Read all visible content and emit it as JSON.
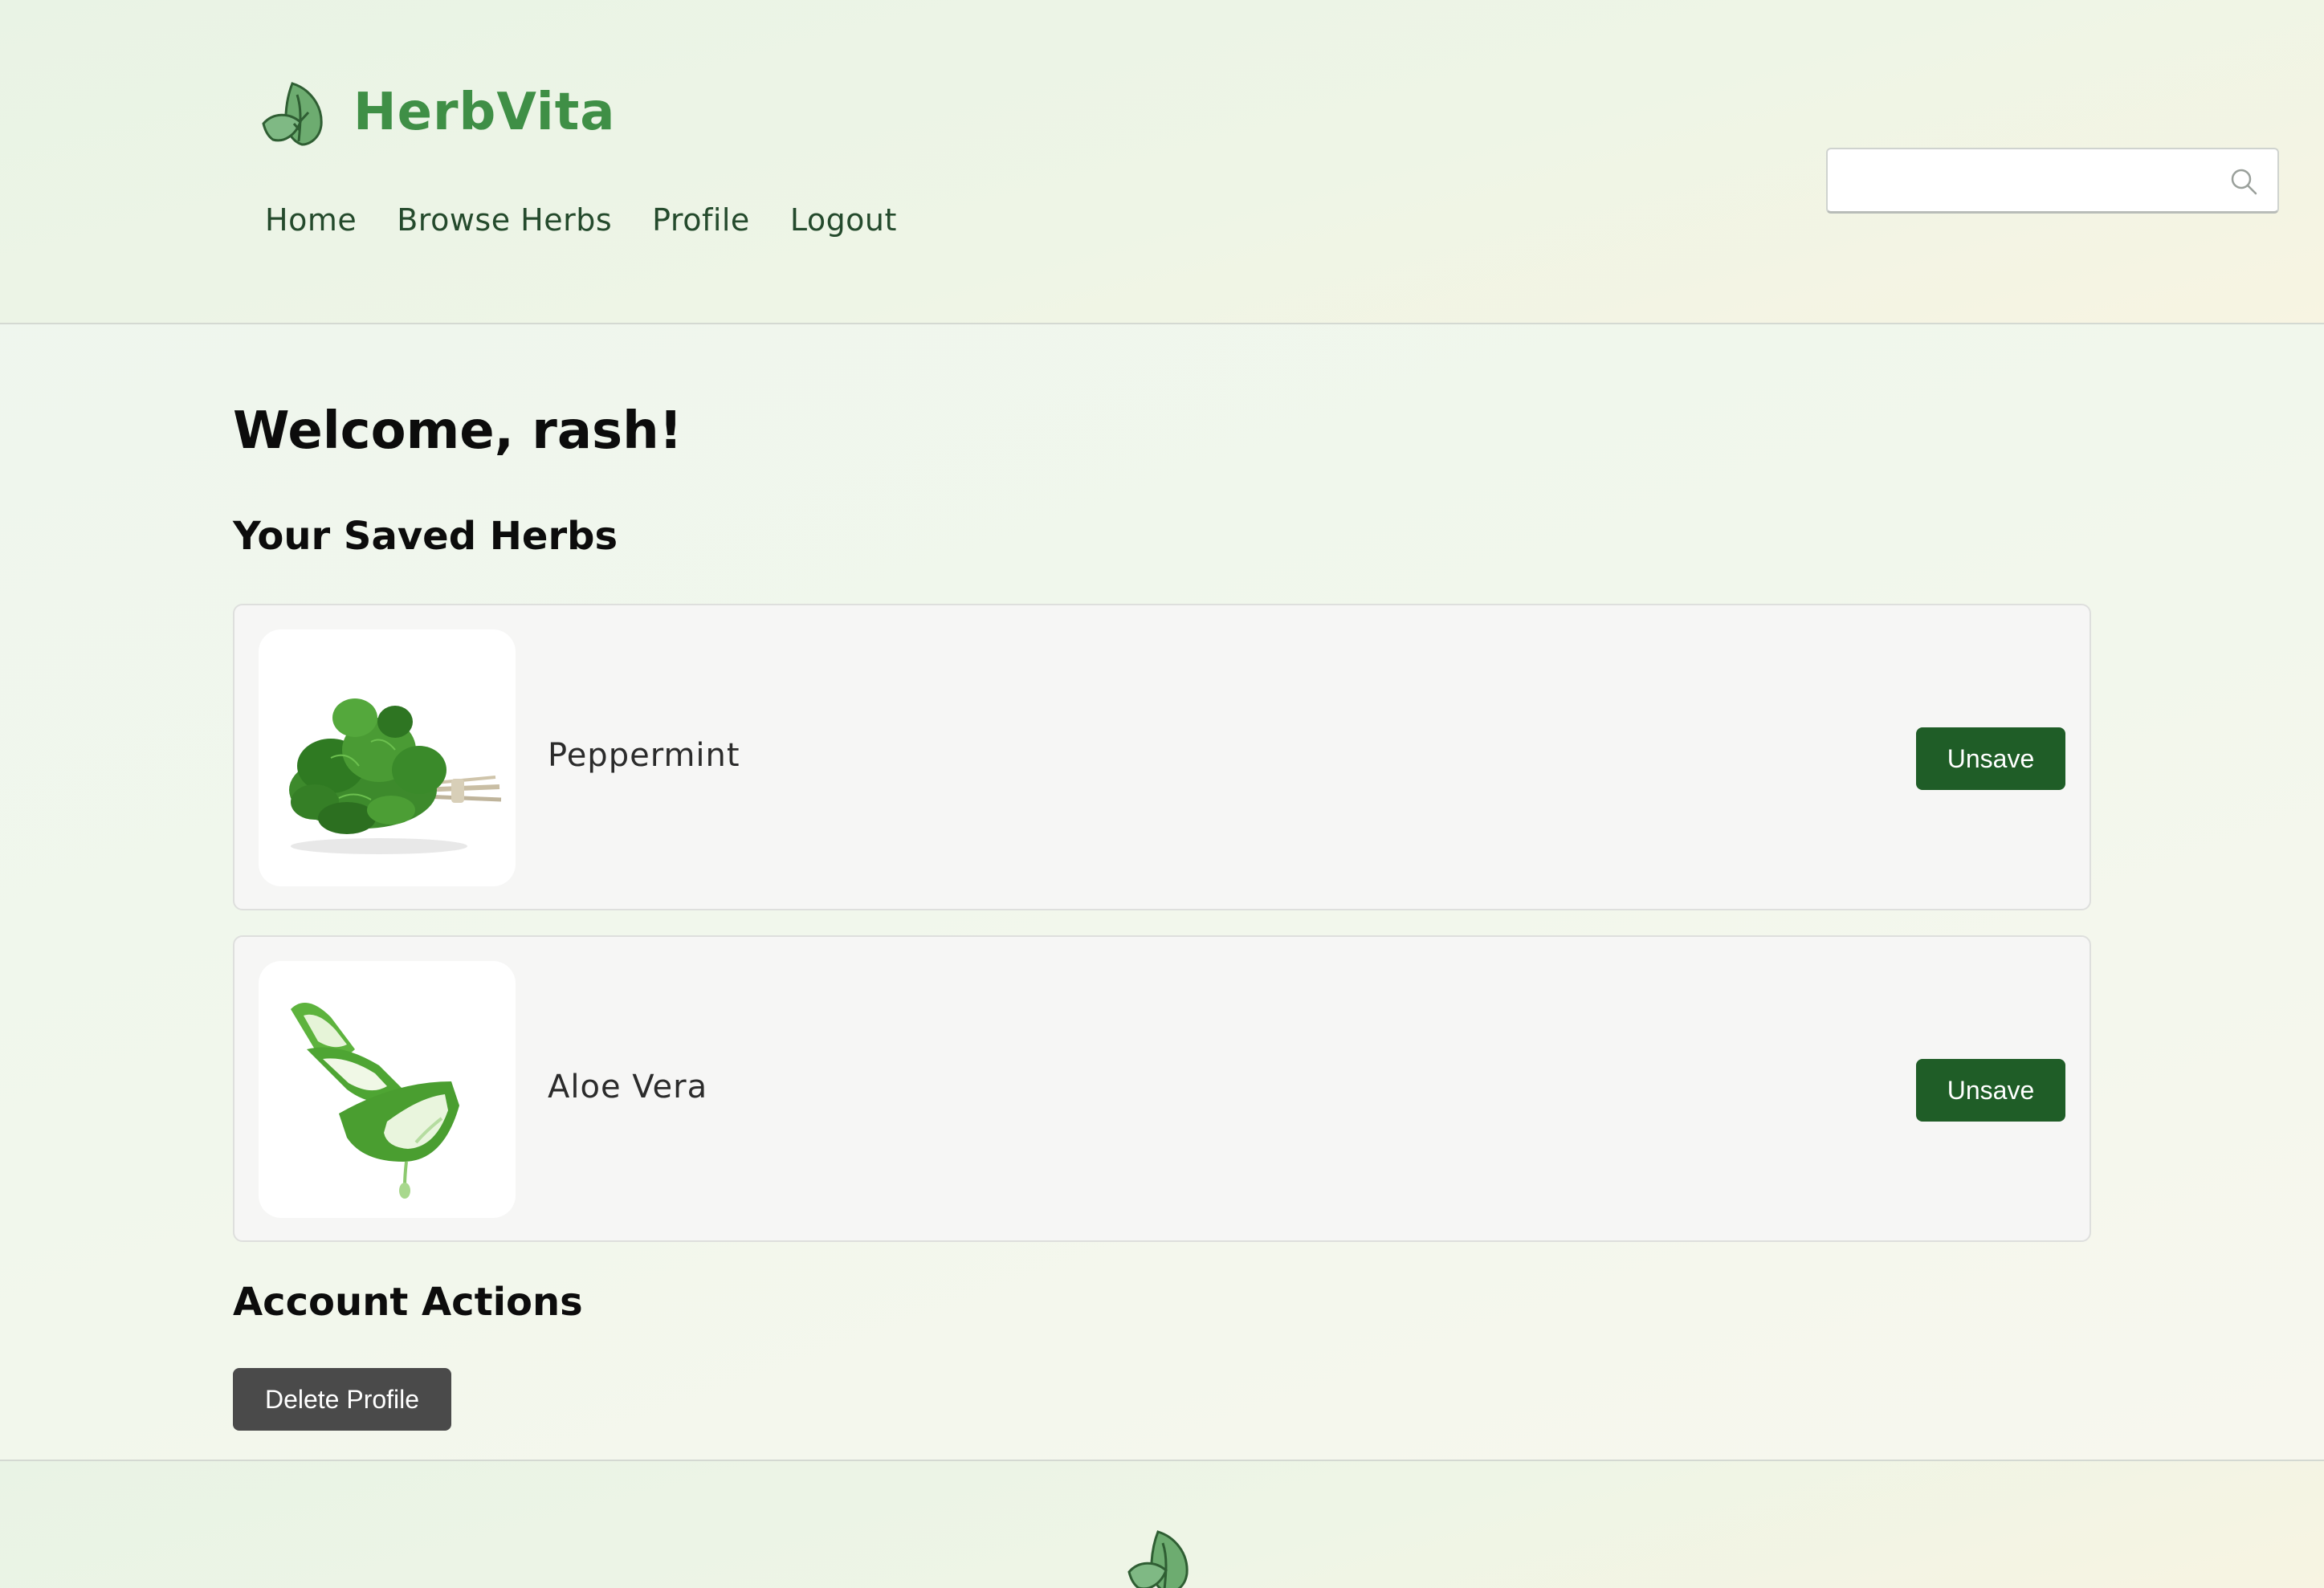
{
  "header": {
    "brand_name": "HerbVita",
    "logo_icon": "leaf-icon",
    "nav": [
      {
        "label": "Home"
      },
      {
        "label": "Browse Herbs"
      },
      {
        "label": "Profile"
      },
      {
        "label": "Logout"
      }
    ],
    "search": {
      "value": "",
      "placeholder": "",
      "icon": "search-icon"
    }
  },
  "main": {
    "welcome": "Welcome, rash!",
    "saved_title": "Your Saved Herbs",
    "saved_herbs": [
      {
        "name": "Peppermint",
        "image": "peppermint-image",
        "action_label": "Unsave"
      },
      {
        "name": "Aloe Vera",
        "image": "aloe-vera-image",
        "action_label": "Unsave"
      }
    ],
    "account_title": "Account Actions",
    "delete_label": "Delete Profile"
  },
  "footer": {
    "logo_icon": "leaf-icon"
  },
  "colors": {
    "brand_green": "#3f8f46",
    "nav_text": "#244a2c",
    "button_green": "#1f5d27",
    "button_gray": "#4a4a4a"
  }
}
